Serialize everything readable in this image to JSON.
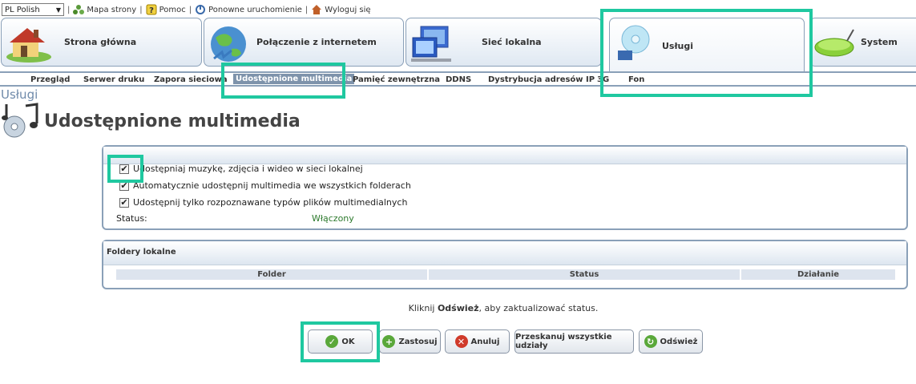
{
  "topbar": {
    "language": "PL Polish",
    "links": [
      "Mapa strony",
      "Pomoc",
      "Ponowne uruchomienie",
      "Wyloguj się"
    ]
  },
  "tabs": [
    {
      "label": "Strona główna",
      "icon": "house-icon"
    },
    {
      "label": "Połączenie z internetem",
      "icon": "globe-icon"
    },
    {
      "label": "Sieć lokalna",
      "icon": "network-computers-icon"
    },
    {
      "label": "Usługi",
      "icon": "disc-icon",
      "active": true
    },
    {
      "label": "System",
      "icon": "router-icon"
    }
  ],
  "subnav": [
    "Przegląd",
    "Serwer druku",
    "Zapora sieciowa",
    "Udostępnione multimedia",
    "Pamięć zewnętrzna",
    "DDNS",
    "Dystrybucja adresów IP",
    "3G",
    "Fon"
  ],
  "breadcrumb": "Usługi",
  "page": {
    "title": "Udostępnione multimedia"
  },
  "options": [
    {
      "label": "Udostępniaj muzykę, zdjęcia i wideo w sieci lokalnej",
      "checked": true
    },
    {
      "label": "Automatycznie udostępnij multimedia we wszystkich folderach",
      "checked": true
    },
    {
      "label": "Udostępnij tylko rozpoznawane typów plików multimedialnych",
      "checked": true
    }
  ],
  "status": {
    "label": "Status:",
    "value": "Włączony"
  },
  "folders": {
    "title": "Foldery lokalne",
    "columns": [
      "Folder",
      "Status",
      "Działanie"
    ]
  },
  "hint": {
    "before": "Kliknij ",
    "bold": "Odśwież",
    "after": ", aby zaktualizować status."
  },
  "buttons": {
    "ok": "OK",
    "apply": "Zastosuj",
    "cancel": "Anuluj",
    "scan": "Przeskanuj wszystkie udziały",
    "refresh": "Odśwież"
  },
  "colors": {
    "accent": "#7e93ab",
    "highlight": "#1fc8a0",
    "status_ok": "#2d7a2d"
  }
}
